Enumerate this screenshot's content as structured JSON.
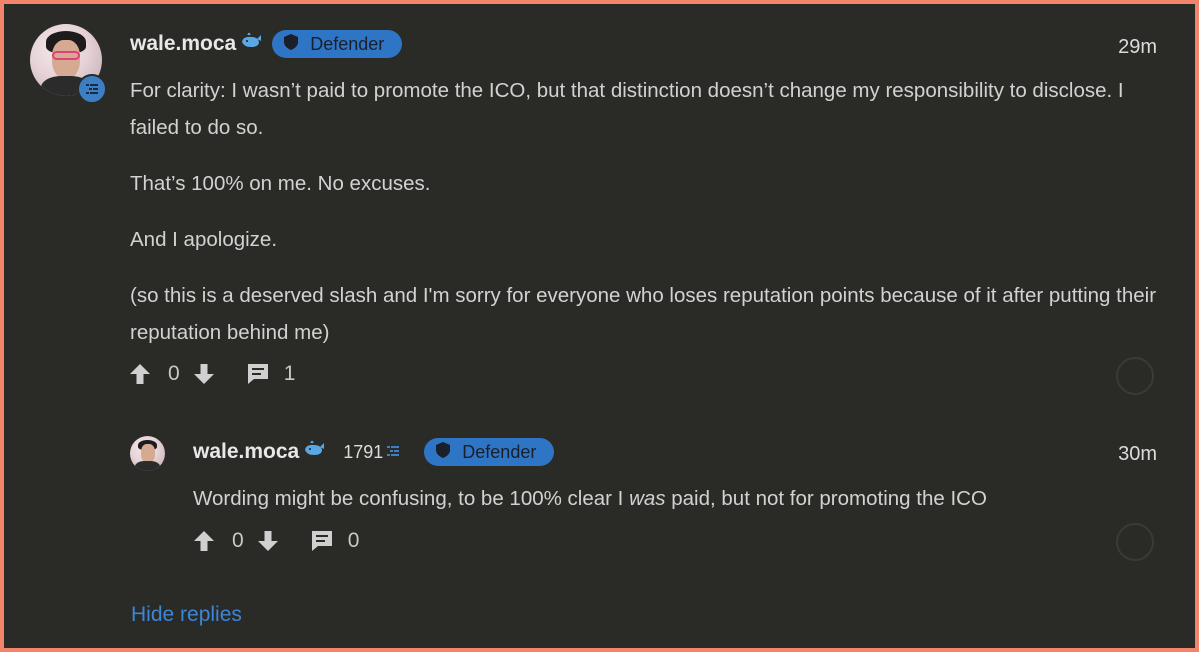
{
  "parent": {
    "username": "wale.moca",
    "badge": "Defender",
    "time": "29m",
    "paragraphs": [
      "For clarity: I wasn’t paid to promote the ICO, but that distinction doesn’t change my responsibility to disclose. I failed to do so.",
      "That’s 100% on me. No excuses.",
      "And I apologize.",
      "(so this is a deserved slash and I'm sorry for everyone who loses reputation points because of it after putting their reputation behind me)"
    ],
    "votes": "0",
    "replies": "1"
  },
  "reply": {
    "username": "wale.moca",
    "karma": "1791",
    "badge": "Defender",
    "time": "30m",
    "text_before": "Wording might be confusing, to be 100% clear I ",
    "text_emph": "was",
    "text_after": " paid, but not for promoting the ICO",
    "votes": "0",
    "replies": "0"
  },
  "hide_replies_label": "Hide replies",
  "colors": {
    "accent": "#2f75c6",
    "link": "#3b86d8",
    "background": "#2a2a27",
    "border": "#f2846a"
  },
  "icons": [
    "upvote-icon",
    "downvote-icon",
    "comment-icon",
    "shield-icon",
    "whale-icon",
    "reputation-icon"
  ]
}
